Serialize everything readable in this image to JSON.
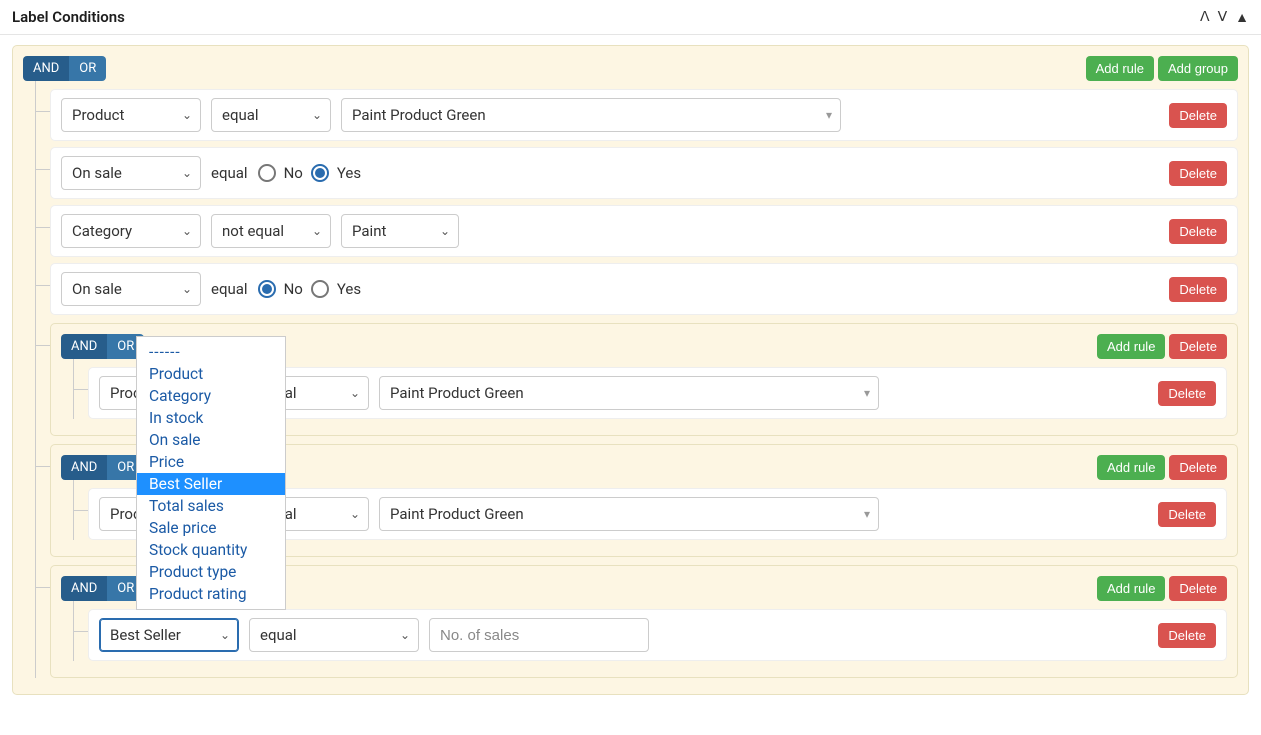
{
  "panel": {
    "title": "Label Conditions"
  },
  "buttons": {
    "add_rule": "Add rule",
    "add_group": "Add group",
    "delete": "Delete",
    "and": "AND",
    "or": "OR"
  },
  "labels": {
    "equal_text": "equal",
    "no": "No",
    "yes": "Yes"
  },
  "root": {
    "rules": [
      {
        "field": "Product",
        "op": "equal",
        "value": "Paint Product Green"
      },
      {
        "field": "On sale",
        "op_text": "equal",
        "radio": "yes"
      },
      {
        "field": "Category",
        "op": "not equal",
        "value": "Paint"
      },
      {
        "field": "On sale",
        "op_text": "equal",
        "radio": "no"
      }
    ],
    "groups": [
      {
        "rules": [
          {
            "field": "Product",
            "op": "equal",
            "value": "Paint Product Green"
          }
        ]
      },
      {
        "rules": [
          {
            "field": "Product",
            "op": "equal",
            "value": "Paint Product Green"
          }
        ]
      },
      {
        "rules": [
          {
            "field": "Best Seller",
            "op": "equal",
            "placeholder": "No. of sales"
          }
        ]
      }
    ]
  },
  "dropdown": {
    "dash": "------",
    "options": [
      "Product",
      "Category",
      "In stock",
      "On sale",
      "Price",
      "Best Seller",
      "Total sales",
      "Sale price",
      "Stock quantity",
      "Product type",
      "Product rating"
    ],
    "highlighted": "Best Seller"
  }
}
